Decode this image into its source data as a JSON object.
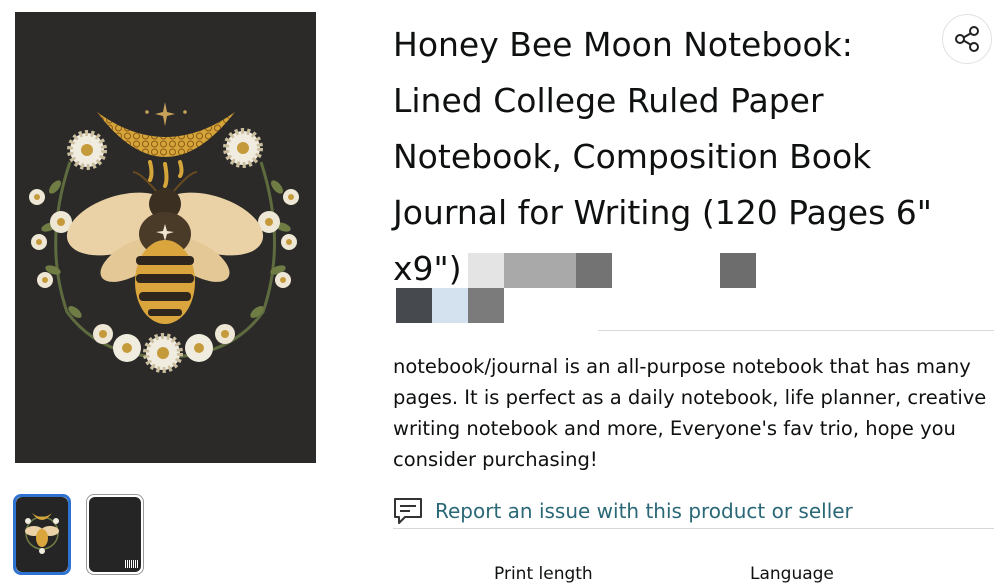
{
  "product": {
    "title": "Honey Bee Moon Notebook: Lined College Ruled Paper Notebook, Composition Book Journal for Writing (120 Pages 6\" x9\")",
    "description": "notebook/journal is an all-purpose notebook that has many pages. It is perfect as a daily notebook, life planner, creative writing notebook and more, Everyone's fav trio, hope you consider purchasing!",
    "report_link": "Report an issue with this product or seller"
  },
  "details": {
    "print_length_label": "Print length",
    "language_label": "Language"
  },
  "icons": {
    "share": "share-icon",
    "report": "report-chat-icon"
  },
  "colors": {
    "cover_background": "#2b2a29",
    "link": "#2a6877",
    "selected_thumbnail_border": "#2e72d2"
  }
}
